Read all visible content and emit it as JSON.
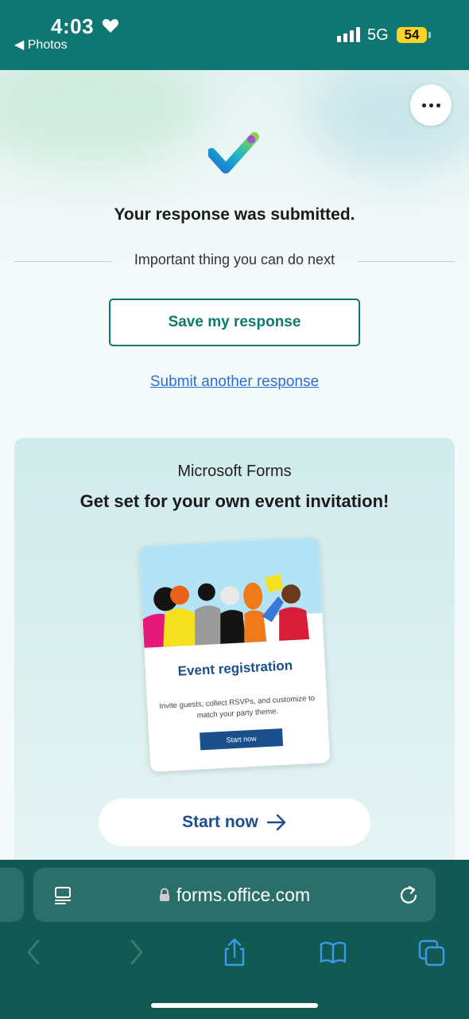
{
  "status_bar": {
    "time": "4:03",
    "back_app": "◀ Photos",
    "network": "5G",
    "battery": "54"
  },
  "page": {
    "more_icon": "more-horizontal-icon",
    "confirmation": "Your response was submitted.",
    "next_divider": "Important thing you can do next",
    "save_button": "Save my response",
    "submit_another_link": "Submit another response"
  },
  "promo": {
    "brand": "Microsoft Forms",
    "title": "Get set for your own event invitation!",
    "card": {
      "title": "Event registration",
      "description": "Invite guests, collect RSVPs, and customize to match your party theme.",
      "button": "Start now"
    },
    "start_button": "Start now"
  },
  "browser": {
    "url": "forms.office.com",
    "nav_icons": [
      "back-icon",
      "forward-icon",
      "share-icon",
      "bookmarks-icon",
      "tabs-icon"
    ]
  },
  "colors": {
    "accent": "#0e7771",
    "link": "#2a6fd1",
    "promo_button_text": "#1a4f8c",
    "browser_bar": "#125954"
  }
}
